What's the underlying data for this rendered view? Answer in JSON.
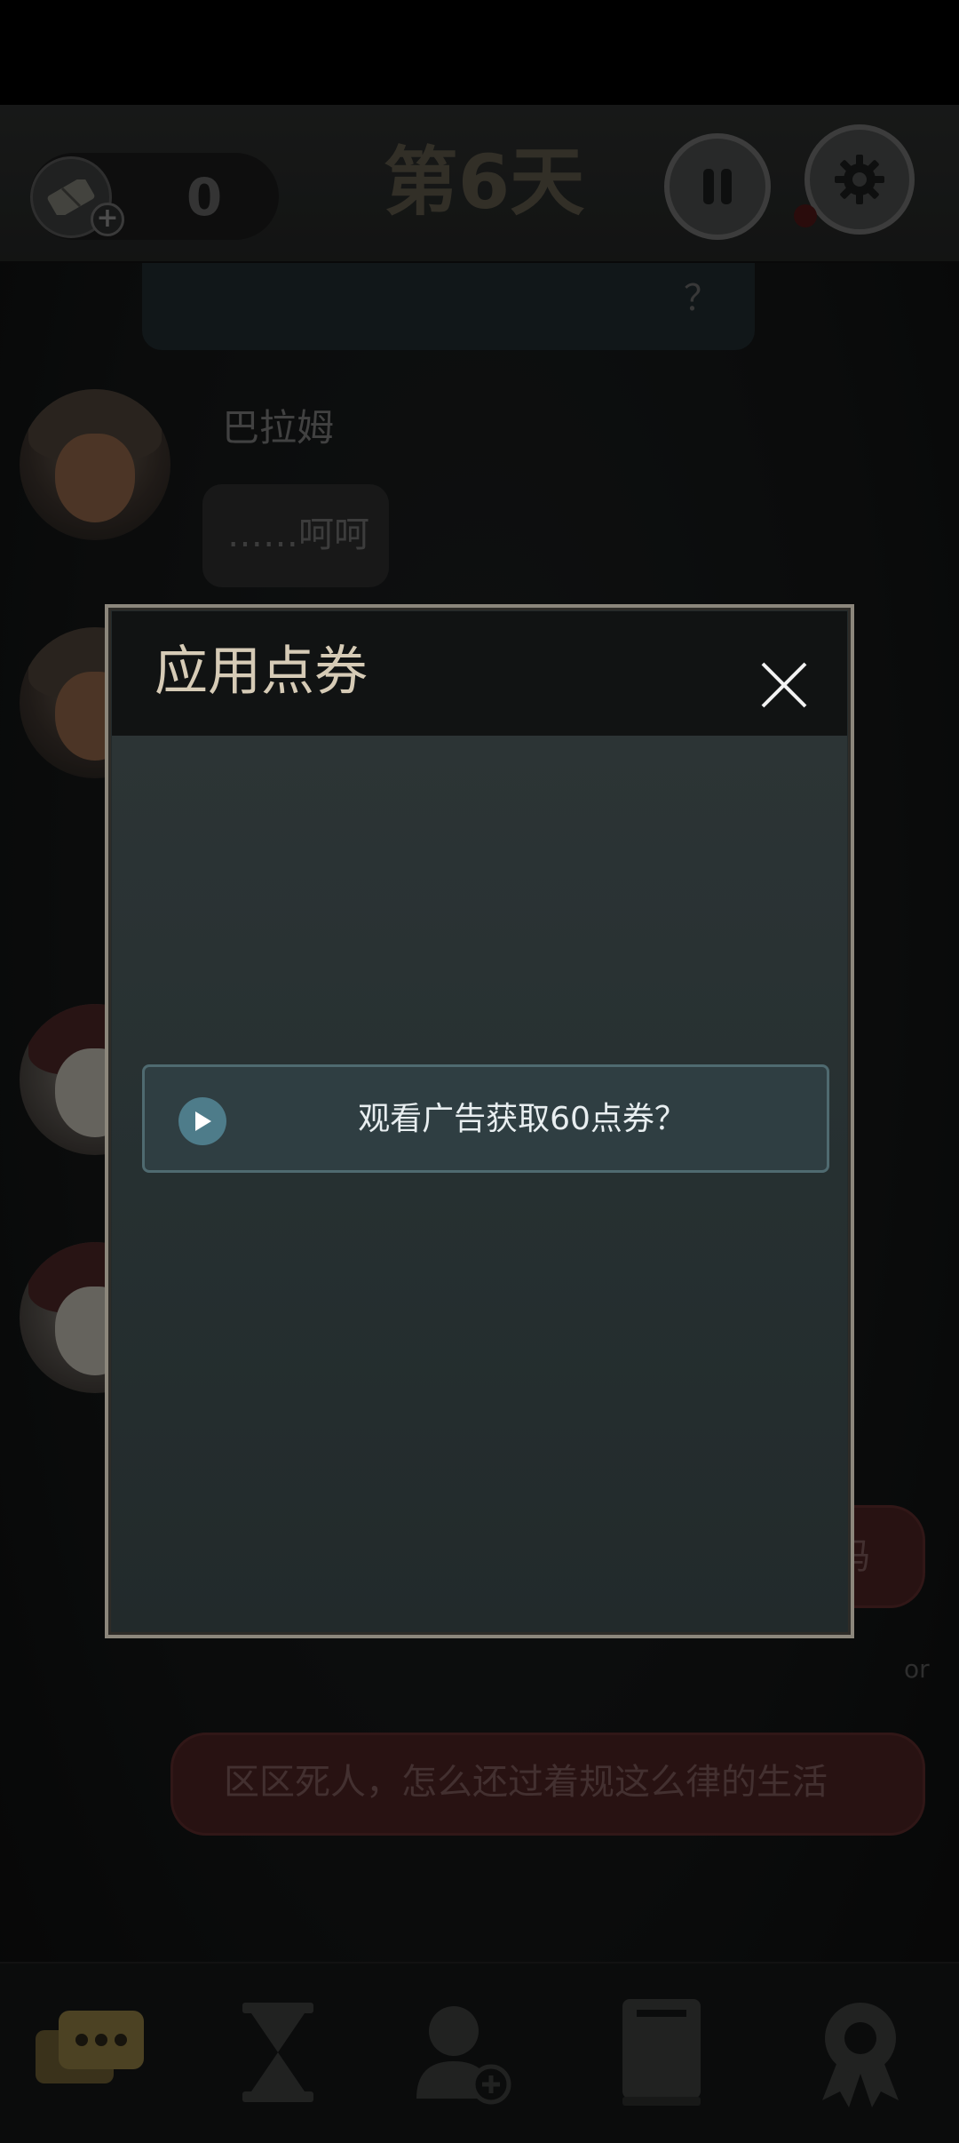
{
  "header": {
    "ticket_count": "0",
    "day_title": "第6天"
  },
  "chat": {
    "top_bubble_text": "？",
    "speaker_name": "巴拉姆",
    "speaker_message": "……呵呵",
    "right_bubble_partial": "吗",
    "side_text": "or",
    "bottom_bubble_text": "区区死人，怎么还过着规这么律的生活"
  },
  "modal": {
    "title": "应用点券",
    "ad_button_label": "观看广告获取60点券？"
  },
  "nav": {
    "icons": [
      "chat-icon",
      "hourglass-icon",
      "add-person-icon",
      "book-icon",
      "medal-icon"
    ]
  },
  "colors": {
    "accent": "#4e7c8a",
    "title_gold": "#d6cbb6",
    "danger_bubble": "#4a2222"
  }
}
